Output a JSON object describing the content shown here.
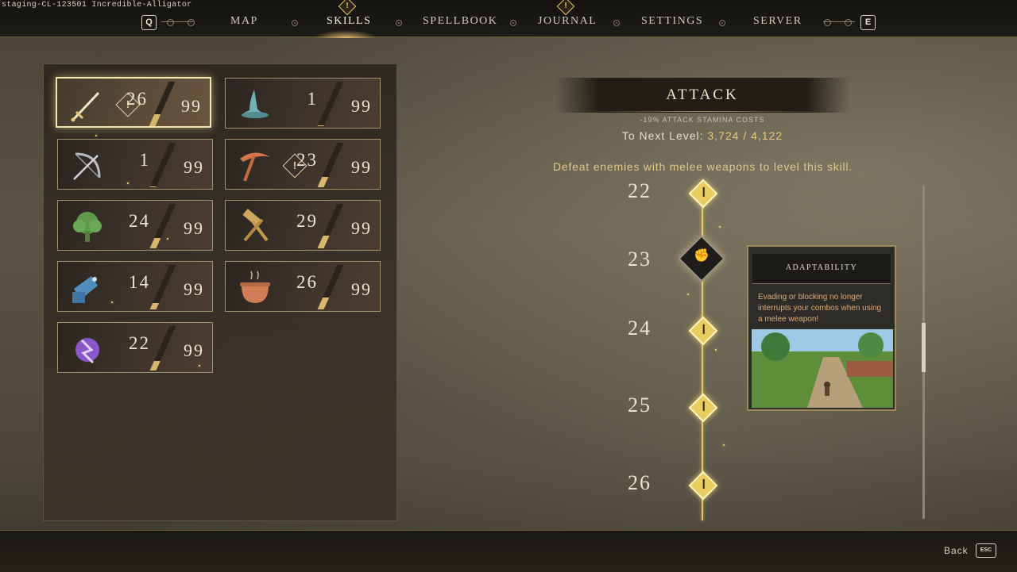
{
  "build_label": "staging-CL-123501 Incredible-Alligator",
  "nav": {
    "prev_key": "Q",
    "next_key": "E",
    "tabs": [
      {
        "label": "MAP",
        "active": false
      },
      {
        "label": "SKILLS",
        "active": true,
        "alert": true
      },
      {
        "label": "SPELLBOOK",
        "active": false
      },
      {
        "label": "JOURNAL",
        "active": false,
        "alert": true
      },
      {
        "label": "SETTINGS",
        "active": false
      },
      {
        "label": "SERVER",
        "active": false
      }
    ],
    "alert_glyph": "!"
  },
  "skills": [
    {
      "name": "attack",
      "icon": "sword-icon",
      "level": "26",
      "max": "99",
      "progress": 0.26,
      "alert": true,
      "selected": true
    },
    {
      "name": "magic",
      "icon": "wizard-hat-icon",
      "level": "1",
      "max": "99",
      "progress": 0.01,
      "alert": false,
      "selected": false
    },
    {
      "name": "archery",
      "icon": "bow-icon",
      "level": "1",
      "max": "99",
      "progress": 0.01,
      "alert": false,
      "selected": false
    },
    {
      "name": "mining",
      "icon": "pickaxe-icon",
      "level": "23",
      "max": "99",
      "progress": 0.23,
      "alert": true,
      "selected": false
    },
    {
      "name": "foraging",
      "icon": "tree-icon",
      "level": "24",
      "max": "99",
      "progress": 0.24,
      "alert": false,
      "selected": false
    },
    {
      "name": "smithing",
      "icon": "hammer-icon",
      "level": "29",
      "max": "99",
      "progress": 0.29,
      "alert": false,
      "selected": false
    },
    {
      "name": "crafting",
      "icon": "saw-icon",
      "level": "14",
      "max": "99",
      "progress": 0.14,
      "alert": false,
      "selected": false
    },
    {
      "name": "cooking",
      "icon": "cauldron-icon",
      "level": "26",
      "max": "99",
      "progress": 0.26,
      "alert": false,
      "selected": false
    },
    {
      "name": "enchanting",
      "icon": "rune-icon",
      "level": "22",
      "max": "99",
      "progress": 0.22,
      "alert": false,
      "selected": false
    }
  ],
  "skill_warn_glyph": "!",
  "detail": {
    "title": "ATTACK",
    "bonus": "-19% ATTACK STAMINA COSTS",
    "next_level_label": "To Next Level:",
    "next_level_value": "3,724 / 4,122",
    "description": "Defeat enemies with melee weapons to level this skill."
  },
  "levels": [
    "22",
    "23",
    "24",
    "25",
    "26"
  ],
  "perk_glyph": "✊",
  "tooltip": {
    "title": "ADAPTABILITY",
    "description": "Evading or blocking no longer interrupts your combos when using a melee weapon!"
  },
  "footer": {
    "back_label": "Back",
    "back_key": "ESC"
  },
  "colors": {
    "accent_gold": "#e9cb5e",
    "tooltip_text": "#e3a770",
    "description_text": "#e4c88c"
  }
}
